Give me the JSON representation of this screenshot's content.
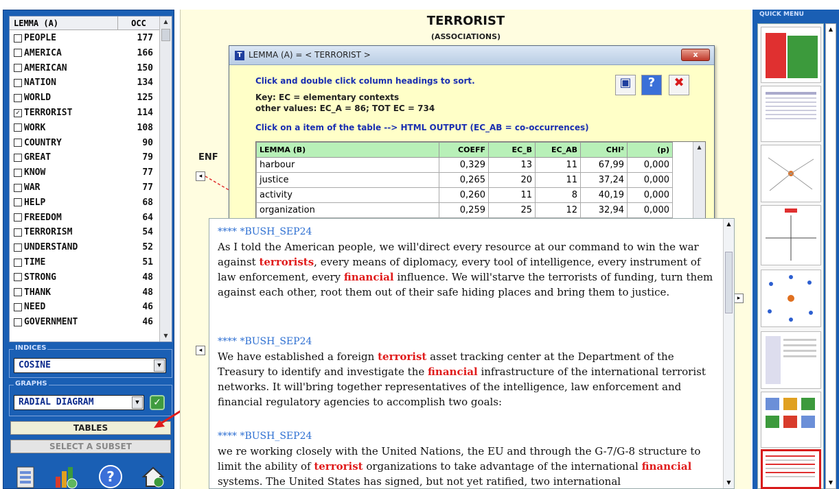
{
  "lemma_list": {
    "col_lemma": "LEMMA (A)",
    "col_occ": "OCC",
    "items": [
      {
        "word": "PEOPLE",
        "occ": "177",
        "checked": false
      },
      {
        "word": "AMERICA",
        "occ": "166",
        "checked": false
      },
      {
        "word": "AMERICAN",
        "occ": "150",
        "checked": false
      },
      {
        "word": "NATION",
        "occ": "134",
        "checked": false
      },
      {
        "word": "WORLD",
        "occ": "125",
        "checked": false
      },
      {
        "word": "TERRORIST",
        "occ": "114",
        "checked": true
      },
      {
        "word": "WORK",
        "occ": "108",
        "checked": false
      },
      {
        "word": "COUNTRY",
        "occ": "90",
        "checked": false
      },
      {
        "word": "GREAT",
        "occ": "79",
        "checked": false
      },
      {
        "word": "KNOW",
        "occ": "77",
        "checked": false
      },
      {
        "word": "WAR",
        "occ": "77",
        "checked": false
      },
      {
        "word": "HELP",
        "occ": "68",
        "checked": false
      },
      {
        "word": "FREEDOM",
        "occ": "64",
        "checked": false
      },
      {
        "word": "TERRORISM",
        "occ": "54",
        "checked": false
      },
      {
        "word": "UNDERSTAND",
        "occ": "52",
        "checked": false
      },
      {
        "word": "TIME",
        "occ": "51",
        "checked": false
      },
      {
        "word": "STRONG",
        "occ": "48",
        "checked": false
      },
      {
        "word": "THANK",
        "occ": "48",
        "checked": false
      },
      {
        "word": "NEED",
        "occ": "46",
        "checked": false
      },
      {
        "word": "GOVERNMENT",
        "occ": "46",
        "checked": false
      }
    ]
  },
  "indices": {
    "legend": "INDICES",
    "value": "COSINE"
  },
  "graphs": {
    "legend": "GRAPHS",
    "value": "RADIAL DIAGRAM"
  },
  "buttons": {
    "tables": "TABLES",
    "select_subset": "SELECT A SUBSET"
  },
  "center": {
    "title": "TERRORIST",
    "subtitle": "(ASSOCIATIONS)",
    "node_label": "ENF"
  },
  "dialog": {
    "title": "LEMMA (A) = < TERRORIST >",
    "close_label": "x",
    "hint": "Click and double click column headings to sort.",
    "key_line1": "Key: EC = elementary contexts",
    "key_line2": "other values: EC_A = 86; TOT EC = 734",
    "click_hint": "Click on a item of the table --> HTML OUTPUT (EC_AB = co-occurrences)",
    "columns": [
      "LEMMA (B)",
      "COEFF",
      "EC_B",
      "EC_AB",
      "CHI²",
      "(p)"
    ],
    "rows": [
      [
        "harbour",
        "0,329",
        "13",
        "11",
        "67,99",
        "0,000"
      ],
      [
        "justice",
        "0,265",
        "20",
        "11",
        "37,24",
        "0,000"
      ],
      [
        "activity",
        "0,260",
        "11",
        "8",
        "40,19",
        "0,000"
      ],
      [
        "organization",
        "0,259",
        "25",
        "12",
        "32,94",
        "0,000"
      ]
    ]
  },
  "output": {
    "paragraphs": [
      {
        "header": "**** *BUSH_SEP24",
        "segments": [
          {
            "t": "As I told the American people, we will'direct every resource at our command to win the war against "
          },
          {
            "t": "terrorists",
            "hl": true
          },
          {
            "t": ", every means of diplomacy, every tool of intelligence, every instrument of law enforcement, every "
          },
          {
            "t": "financial",
            "hl": true
          },
          {
            "t": " influence. We will'starve the terrorists of funding, turn them against each other, root them out of their safe hiding places and bring them to justice."
          }
        ]
      },
      {
        "header": "**** *BUSH_SEP24",
        "segments": [
          {
            "t": "We have established a foreign "
          },
          {
            "t": "terrorist",
            "hl": true
          },
          {
            "t": " asset tracking center at the Department of the Treasury to identify and investigate the "
          },
          {
            "t": "financial",
            "hl": true
          },
          {
            "t": " infrastructure of the international terrorist networks. It will'bring together representatives of the intelligence, law enforcement and financial regulatory agencies to accomplish two goals:"
          }
        ]
      },
      {
        "header": "**** *BUSH_SEP24",
        "segments": [
          {
            "t": "we re working closely with the United Nations, the EU and through the G-7/G-8 structure to limit the ability of "
          },
          {
            "t": "terrorist",
            "hl": true
          },
          {
            "t": " organizations to take advantage of the international "
          },
          {
            "t": "financial",
            "hl": true
          },
          {
            "t": " systems. The United States has signed, but not yet ratified, two international"
          }
        ]
      }
    ]
  },
  "quick_menu": {
    "label": "QUICK MENU"
  },
  "colors": {
    "panel_blue": "#1a5fb4",
    "highlight_red": "#e01b1b",
    "header_blue": "#2d6fd2",
    "table_header_green": "#b8f0b8",
    "canvas_yellow": "#fffde0"
  }
}
